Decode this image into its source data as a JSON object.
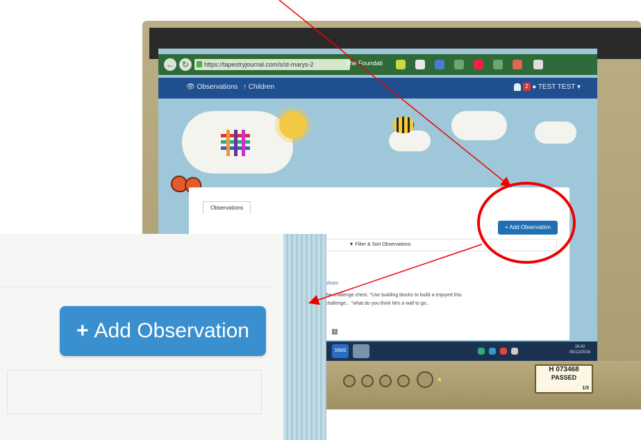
{
  "browser": {
    "url": "https://tapestryjournal.com/s/st-marys-2",
    "tab_title": "The Foundati"
  },
  "app_nav": {
    "observations_label": "Observations",
    "children_label": "Children",
    "notification_count": "2",
    "user_label": "TEST TEST"
  },
  "panel": {
    "tab_label": "Observations",
    "add_button_label": "Add Observation",
    "filter_label": "Filter & Sort Observations",
    "child_name": "ultram",
    "observation_text": "the challenge chest. \"Use building blocks to build a enjoyed this challenge... \"what do you think Mrs a wall to go..",
    "mini_badge": "1"
  },
  "taskbar": {
    "sims_label": "SIMS",
    "time": "16:42",
    "date": "05/12/2016"
  },
  "sticker": {
    "id": "H 073468",
    "status": "PASSED",
    "fraction": "1/3"
  },
  "inset": {
    "add_button_label": "Add Observation"
  },
  "colors": {
    "annotation_red": "#ee0000",
    "button_blue": "#3a8fcf",
    "nav_blue": "#1f4f8f"
  }
}
